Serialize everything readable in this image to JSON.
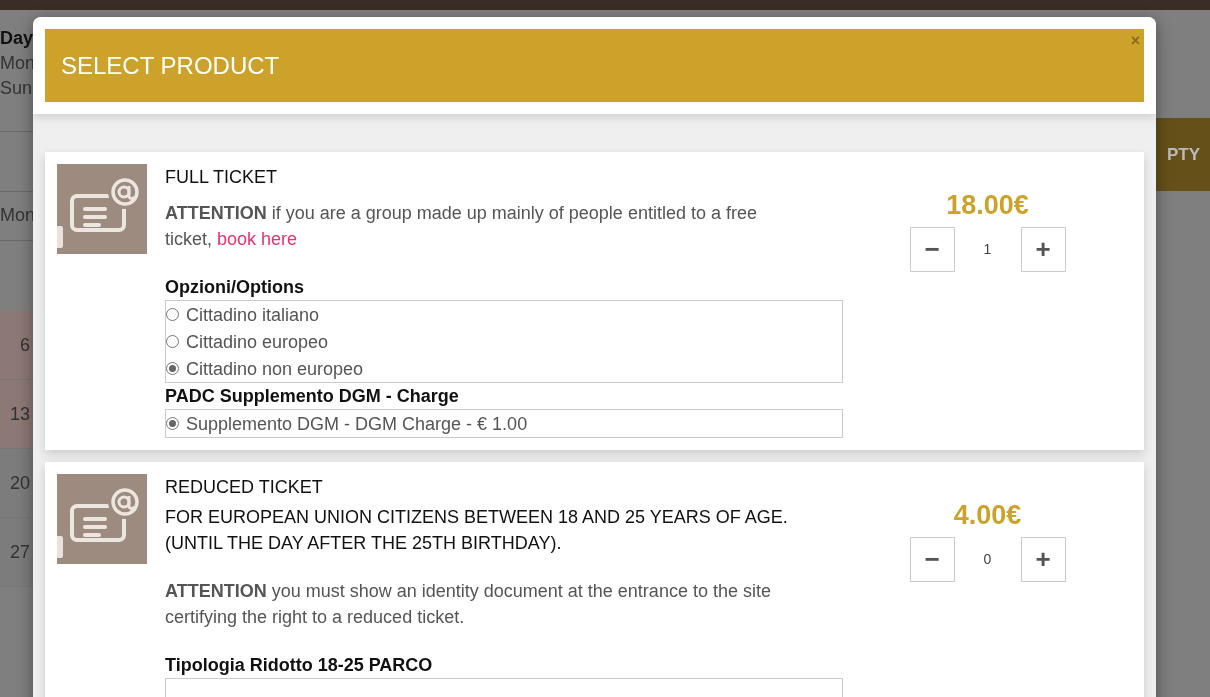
{
  "background": {
    "heading": "Day",
    "days": [
      "Mon",
      "Sun"
    ],
    "tab": "Mon",
    "calendar_days": [
      {
        "label": "6",
        "kind": "highlighted"
      },
      {
        "label": "13",
        "kind": "highlighted"
      },
      {
        "label": "20",
        "kind": "plain"
      },
      {
        "label": "27",
        "kind": "plain"
      }
    ],
    "button": "PTY"
  },
  "modal": {
    "title": "SELECT PRODUCT",
    "close": "×",
    "products": [
      {
        "name": "FULL TICKET",
        "attention": "**ATTENTION** if you are a group made up mainly of people entitled to a free ticket,",
        "link": "book here",
        "price": "18.00€",
        "quantity": "1",
        "minus": "−",
        "plus": "+",
        "option_groups": [
          {
            "title": "Opzioni/Options",
            "options": [
              {
                "label": "Cittadino italiano",
                "selected": false
              },
              {
                "label": "Cittadino europeo",
                "selected": false
              },
              {
                "label": "Cittadino non europeo",
                "selected": true
              }
            ]
          },
          {
            "title": "PADC Supplemento DGM - Charge",
            "options": [
              {
                "label": "Supplemento DGM - DGM Charge - € 1.00",
                "selected": true
              }
            ]
          }
        ]
      },
      {
        "name": "REDUCED TICKET",
        "description": "FOR EUROPEAN UNION CITIZENS BETWEEN 18 AND 25 YEARS OF AGE. (UNTIL THE DAY AFTER THE 25TH BIRTHDAY).",
        "attention": "**ATTENTION** you must show an identity document at the entrance to the site certifying the right to a reduced ticket.",
        "price": "4.00€",
        "quantity": "0",
        "minus": "−",
        "plus": "+",
        "option_groups": [
          {
            "title": "Tipologia Ridotto 18-25 PARCO"
          }
        ]
      }
    ]
  }
}
